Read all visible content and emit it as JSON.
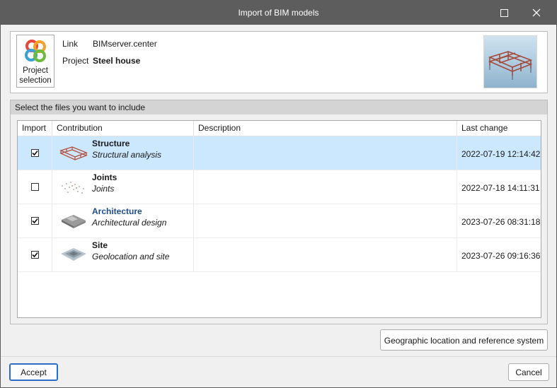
{
  "window": {
    "title": "Import of BIM models",
    "maximize_icon": "maximize-icon",
    "close_icon": "close-icon"
  },
  "project": {
    "button_label_line1": "Project",
    "button_label_line2": "selection",
    "link_label": "Link",
    "link_value": "BIMserver.center",
    "project_label": "Project",
    "project_value": "Steel house",
    "thumbnail_icon": "steel-house-thumbnail"
  },
  "files": {
    "header": "Select the files you want to include",
    "columns": [
      "Import",
      "Contribution",
      "Description",
      "Last change"
    ],
    "rows": [
      {
        "checked": true,
        "title": "Structure",
        "subtitle": "Structural analysis",
        "description": "",
        "last_change": "2022-07-19 12:14:42",
        "icon": "structure-model-icon",
        "selected": true
      },
      {
        "checked": false,
        "title": "Joints",
        "subtitle": "Joints",
        "description": "",
        "last_change": "2022-07-18 14:11:31",
        "icon": "joints-model-icon",
        "selected": false
      },
      {
        "checked": true,
        "title": "Architecture",
        "subtitle": "Architectural design",
        "description": "",
        "last_change": "2023-07-26 08:31:18",
        "icon": "architecture-model-icon",
        "selected": false
      },
      {
        "checked": true,
        "title": "Site",
        "subtitle": "Geolocation and site",
        "description": "",
        "last_change": "2023-07-26 09:16:36",
        "icon": "site-model-icon",
        "selected": false
      }
    ]
  },
  "buttons": {
    "geo": "Geographic location and reference system",
    "accept": "Accept",
    "cancel": "Cancel"
  },
  "colors": {
    "titlebar": "#5d5d5d",
    "selected_row": "#cce8ff",
    "link_title": "#1f4d8c",
    "accept_border": "#2b6cc4"
  }
}
